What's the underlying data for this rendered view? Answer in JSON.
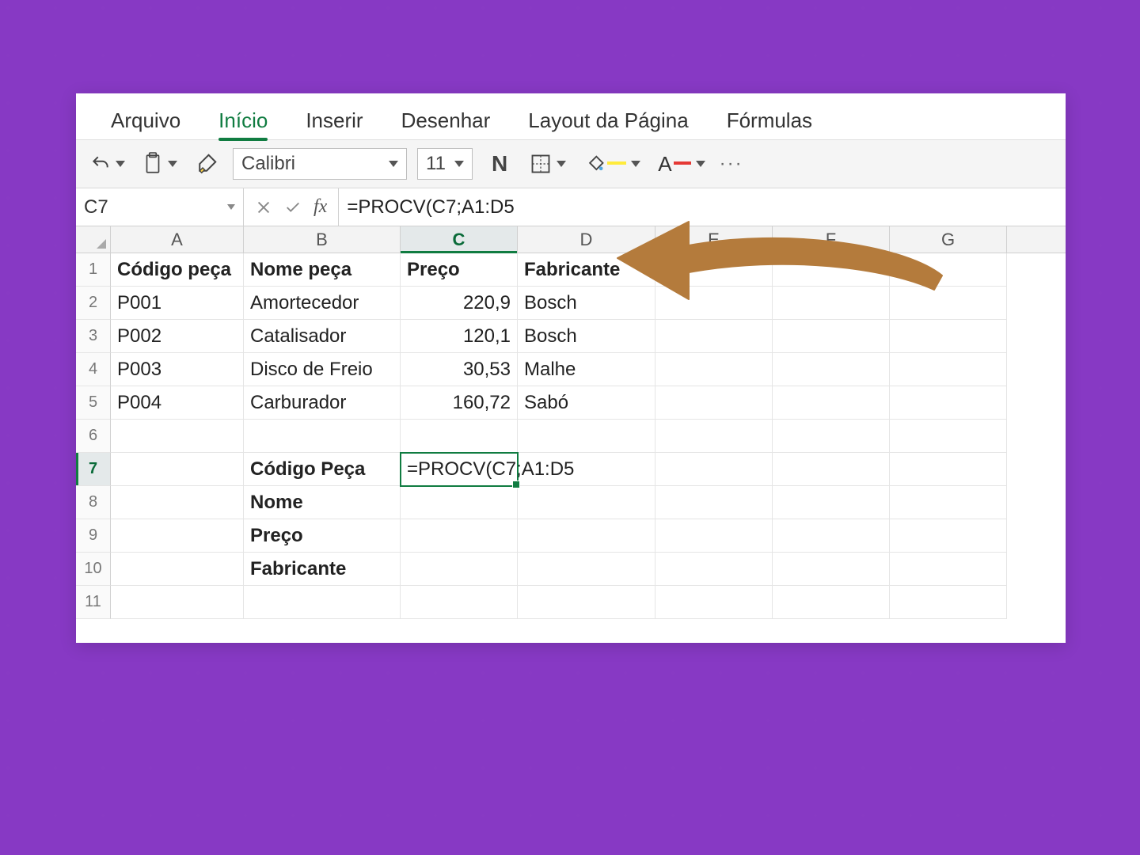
{
  "ribbon": {
    "tabs": [
      "Arquivo",
      "Início",
      "Inserir",
      "Desenhar",
      "Layout da Página",
      "Fórmulas"
    ],
    "active_index": 1
  },
  "toolbar": {
    "font_name": "Calibri",
    "font_size": "11",
    "bold_label": "N"
  },
  "formula_bar": {
    "name_box": "C7",
    "fx_label": "fx",
    "formula": "=PROCV(C7;A1:D5"
  },
  "columns": [
    "A",
    "B",
    "C",
    "D",
    "E",
    "F",
    "G"
  ],
  "active_column_index": 2,
  "active_row_index": 6,
  "rows": [
    {
      "num": "1",
      "cells": [
        {
          "t": "Código peça",
          "b": true
        },
        {
          "t": "Nome peça",
          "b": true
        },
        {
          "t": "Preço",
          "b": true
        },
        {
          "t": "Fabricante",
          "b": true
        },
        {
          "t": ""
        },
        {
          "t": ""
        },
        {
          "t": ""
        }
      ]
    },
    {
      "num": "2",
      "cells": [
        {
          "t": "P001"
        },
        {
          "t": "Amortecedor"
        },
        {
          "t": "220,9",
          "r": true
        },
        {
          "t": "Bosch"
        },
        {
          "t": ""
        },
        {
          "t": ""
        },
        {
          "t": ""
        }
      ]
    },
    {
      "num": "3",
      "cells": [
        {
          "t": "P002"
        },
        {
          "t": "Catalisador"
        },
        {
          "t": "120,1",
          "r": true
        },
        {
          "t": "Bosch"
        },
        {
          "t": ""
        },
        {
          "t": ""
        },
        {
          "t": ""
        }
      ]
    },
    {
      "num": "4",
      "cells": [
        {
          "t": "P003"
        },
        {
          "t": "Disco de Freio"
        },
        {
          "t": "30,53",
          "r": true
        },
        {
          "t": "Malhe"
        },
        {
          "t": ""
        },
        {
          "t": ""
        },
        {
          "t": ""
        }
      ]
    },
    {
      "num": "5",
      "cells": [
        {
          "t": "P004"
        },
        {
          "t": "Carburador"
        },
        {
          "t": "160,72",
          "r": true
        },
        {
          "t": "Sabó"
        },
        {
          "t": ""
        },
        {
          "t": ""
        },
        {
          "t": ""
        }
      ]
    },
    {
      "num": "6",
      "cells": [
        {
          "t": ""
        },
        {
          "t": ""
        },
        {
          "t": ""
        },
        {
          "t": ""
        },
        {
          "t": ""
        },
        {
          "t": ""
        },
        {
          "t": ""
        }
      ]
    },
    {
      "num": "7",
      "cells": [
        {
          "t": ""
        },
        {
          "t": "Código Peça",
          "b": true
        },
        {
          "t": "=PROCV(C7;A1:D5",
          "sel": true
        },
        {
          "t": ""
        },
        {
          "t": ""
        },
        {
          "t": ""
        },
        {
          "t": ""
        }
      ]
    },
    {
      "num": "8",
      "cells": [
        {
          "t": ""
        },
        {
          "t": "Nome",
          "b": true
        },
        {
          "t": ""
        },
        {
          "t": ""
        },
        {
          "t": ""
        },
        {
          "t": ""
        },
        {
          "t": ""
        }
      ]
    },
    {
      "num": "9",
      "cells": [
        {
          "t": ""
        },
        {
          "t": "Preço",
          "b": true
        },
        {
          "t": ""
        },
        {
          "t": ""
        },
        {
          "t": ""
        },
        {
          "t": ""
        },
        {
          "t": ""
        }
      ]
    },
    {
      "num": "10",
      "cells": [
        {
          "t": ""
        },
        {
          "t": "Fabricante",
          "b": true
        },
        {
          "t": ""
        },
        {
          "t": ""
        },
        {
          "t": ""
        },
        {
          "t": ""
        },
        {
          "t": ""
        }
      ]
    },
    {
      "num": "11",
      "cells": [
        {
          "t": ""
        },
        {
          "t": ""
        },
        {
          "t": ""
        },
        {
          "t": ""
        },
        {
          "t": ""
        },
        {
          "t": ""
        },
        {
          "t": ""
        }
      ]
    }
  ]
}
